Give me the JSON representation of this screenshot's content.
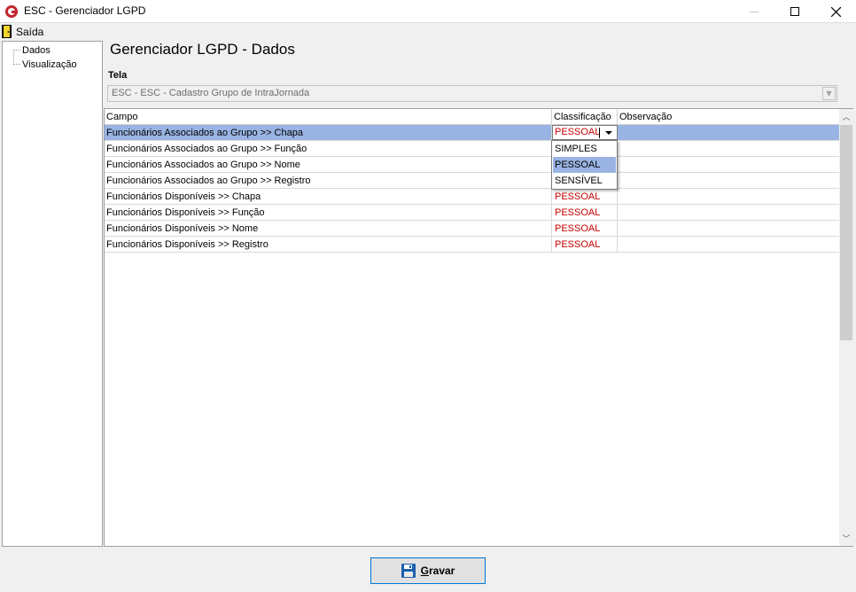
{
  "window": {
    "title": "ESC - Gerenciador LGPD"
  },
  "menu": {
    "saida_label": "Saída"
  },
  "tree": {
    "items": [
      {
        "label": "Dados"
      },
      {
        "label": "Visualização"
      }
    ]
  },
  "main": {
    "title": "Gerenciador LGPD - Dados",
    "tela_label": "Tela",
    "tela_value": "ESC - ESC - Cadastro Grupo de IntraJornada"
  },
  "grid": {
    "columns": [
      "Campo",
      "Classificação",
      "Observação"
    ],
    "rows": [
      {
        "campo": "Funcionários Associados ao Grupo >> Chapa",
        "classificacao": "PESSOAL",
        "observacao": ""
      },
      {
        "campo": "Funcionários Associados ao Grupo >> Função",
        "classificacao": "",
        "observacao": ""
      },
      {
        "campo": "Funcionários Associados ao Grupo >> Nome",
        "classificacao": "",
        "observacao": ""
      },
      {
        "campo": "Funcionários Associados ao Grupo >> Registro",
        "classificacao": "",
        "observacao": ""
      },
      {
        "campo": "Funcionários Disponíveis >> Chapa",
        "classificacao": "PESSOAL",
        "observacao": ""
      },
      {
        "campo": "Funcionários Disponíveis >> Função",
        "classificacao": "PESSOAL",
        "observacao": ""
      },
      {
        "campo": "Funcionários Disponíveis >> Nome",
        "classificacao": "PESSOAL",
        "observacao": ""
      },
      {
        "campo": "Funcionários Disponíveis >> Registro",
        "classificacao": "PESSOAL",
        "observacao": ""
      }
    ],
    "dropdown_options": [
      "SIMPLES",
      "PESSOAL",
      "SENSÍVEL"
    ],
    "dropdown_highlighted": "PESSOAL"
  },
  "footer": {
    "save_label_first": "G",
    "save_label_rest": "ravar"
  },
  "colors": {
    "selection": "#99b4e3",
    "classification_text": "#cc0000",
    "button_border": "#0078d7"
  },
  "icons": {
    "app": "esc-logo-icon",
    "menu": "exit-door-icon",
    "save": "floppy-disk-icon"
  }
}
